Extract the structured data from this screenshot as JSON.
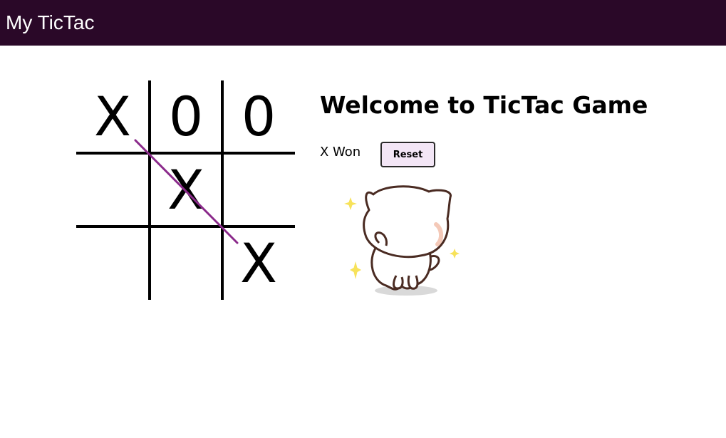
{
  "app": {
    "title": "My TicTac"
  },
  "game": {
    "heading": "Welcome to TicTac Game",
    "status": "X Won",
    "reset_label": "Reset",
    "board": [
      "X",
      "0",
      "0",
      "",
      "X",
      "",
      "",
      "",
      "X"
    ],
    "winning_line": [
      0,
      4,
      8
    ],
    "winline_color": "#8b2a8b"
  },
  "colors": {
    "appbar": "#2a0828",
    "reset_bg": "#f3e6f6"
  },
  "sticker": {
    "icon": "celebrating-cat-sticker"
  }
}
